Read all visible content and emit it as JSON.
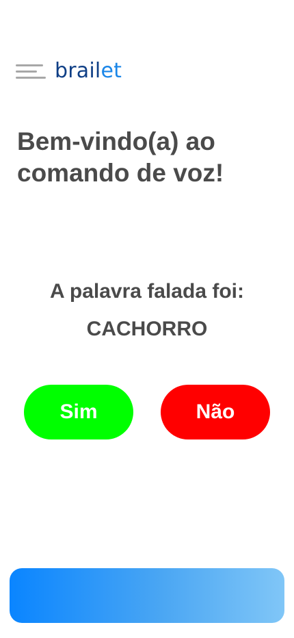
{
  "header": {
    "menu_icon": "hamburger-menu-icon",
    "brand_prefix": "brail",
    "brand_suffix": "et",
    "brand_color": "#0f3f86",
    "brand_accent_color": "#1a86e8"
  },
  "welcome": {
    "title": "Bem-vindo(a) ao comando de voz!"
  },
  "recognition": {
    "label": "A palavra falada foi:",
    "word": "CACHORRO"
  },
  "actions": {
    "yes_label": "Sim",
    "yes_color": "#00ff00",
    "no_label": "Não",
    "no_color": "#ff0000"
  },
  "bottom_bar": {
    "gradient_start": "#0a85ff",
    "gradient_end": "#80c6f7"
  }
}
